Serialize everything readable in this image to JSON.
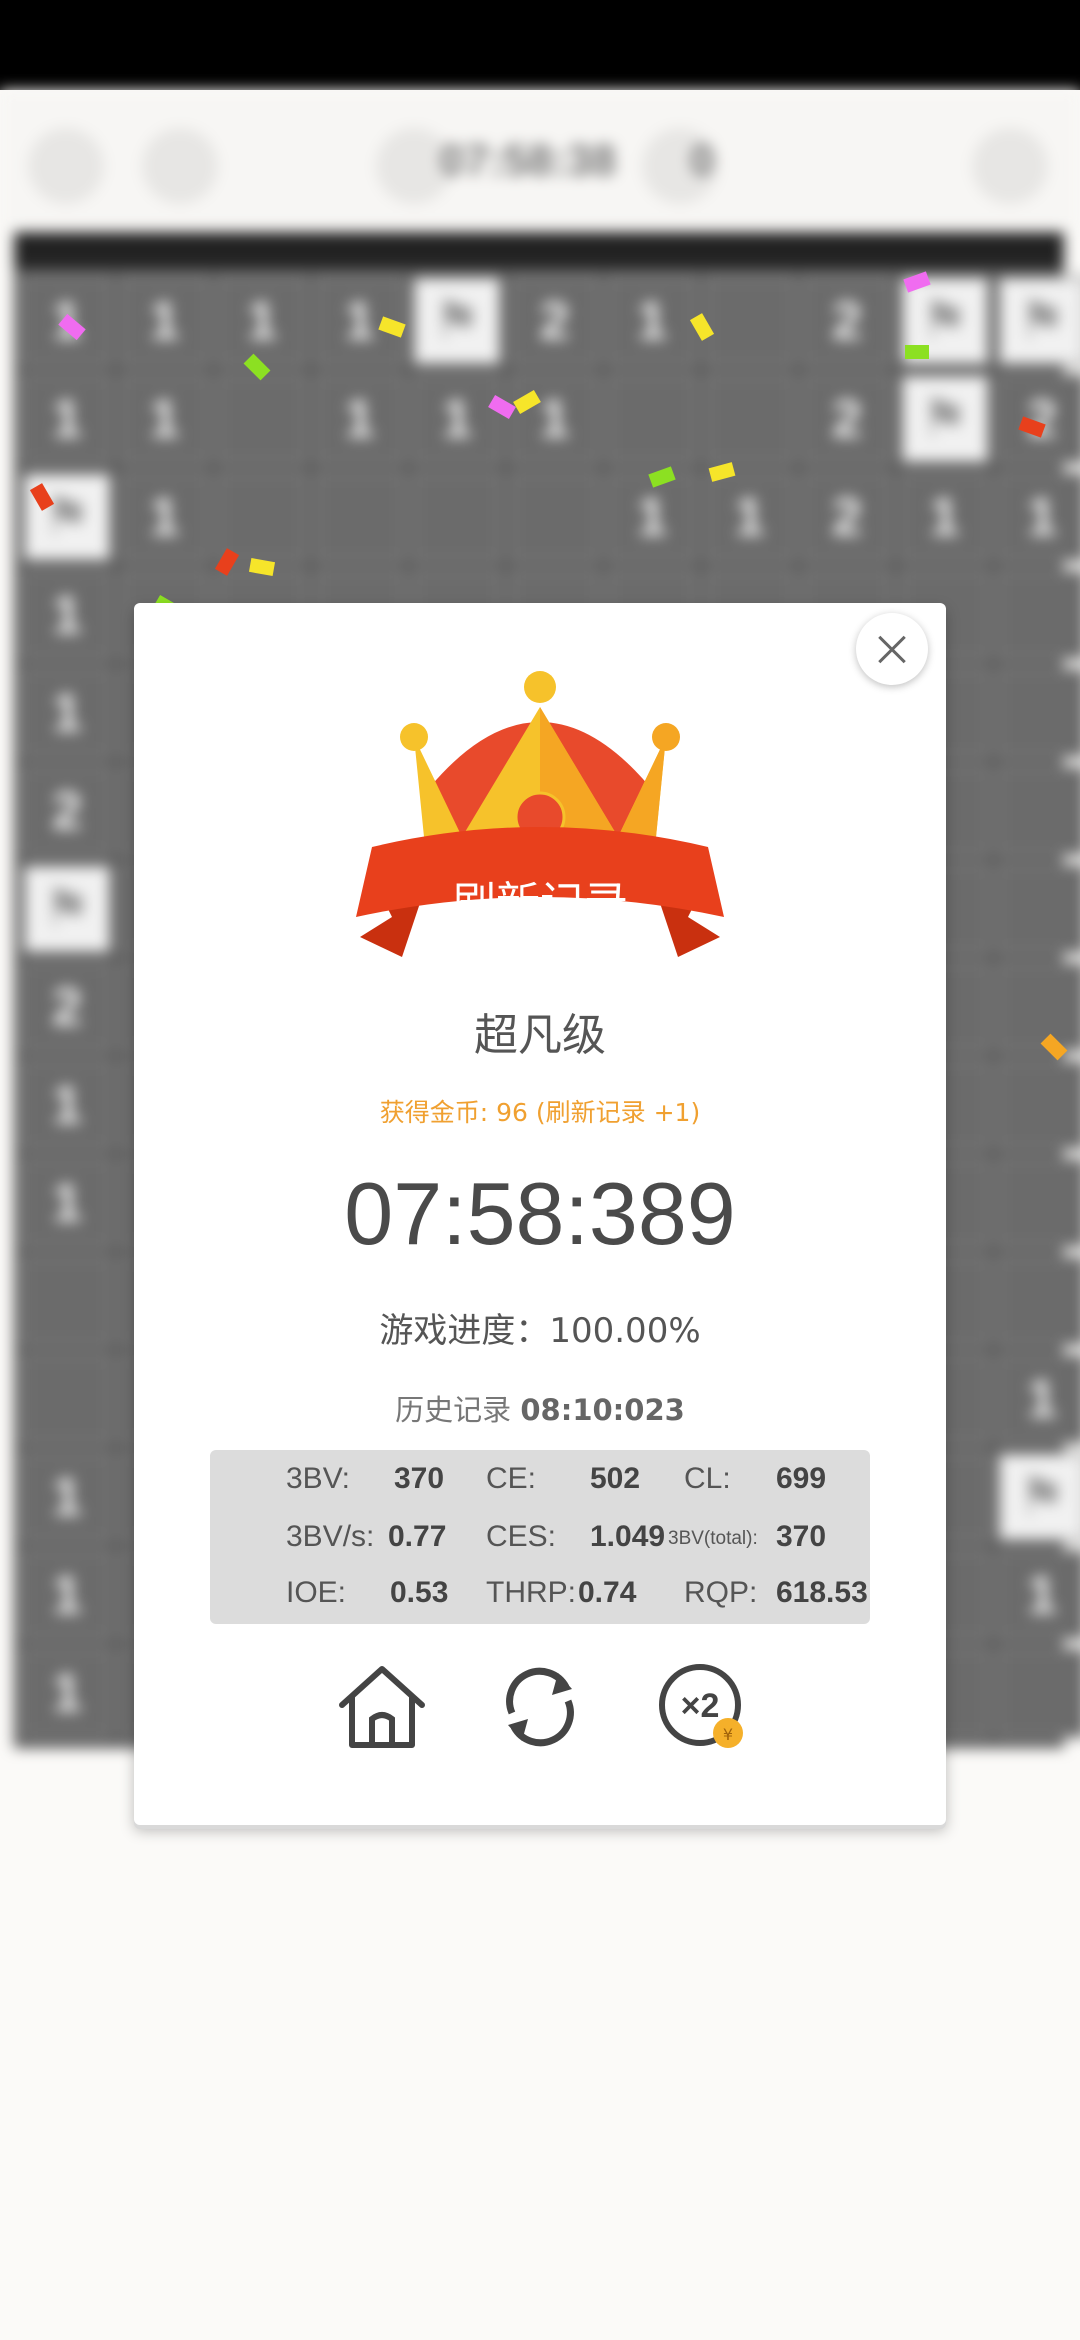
{
  "toolbar": {
    "timer": "07:58:38",
    "flags": "0"
  },
  "board": {
    "rows": [
      [
        "1",
        "1",
        "1",
        "1",
        "F",
        "2",
        "1",
        "",
        "2",
        "F",
        "F"
      ],
      [
        "1",
        "1",
        "",
        "1",
        "1",
        "1",
        "",
        "",
        "2",
        "F",
        "2"
      ],
      [
        "F",
        "1",
        "",
        "",
        "",
        "",
        "1",
        "1",
        "2",
        "1",
        "1"
      ],
      [
        "1",
        "",
        "",
        "",
        "",
        "",
        "",
        "",
        "",
        "",
        ""
      ],
      [
        "1",
        "",
        "",
        "",
        "",
        "",
        "",
        "",
        "",
        "",
        ""
      ],
      [
        "2",
        "",
        "",
        "",
        "",
        "",
        "",
        "",
        "",
        "",
        ""
      ],
      [
        "F",
        "",
        "",
        "",
        "",
        "",
        "",
        "",
        "",
        "",
        ""
      ],
      [
        "2",
        "",
        "",
        "",
        "",
        "",
        "",
        "",
        "",
        "",
        ""
      ],
      [
        "1",
        "",
        "",
        "",
        "",
        "",
        "",
        "",
        "",
        "",
        ""
      ],
      [
        "1",
        "",
        "",
        "",
        "",
        "",
        "",
        "",
        "",
        "",
        ""
      ],
      [
        "",
        "",
        "",
        "",
        "",
        "",
        "",
        "",
        "",
        "",
        ""
      ],
      [
        "",
        "",
        "",
        "",
        "",
        "",
        "",
        "",
        "",
        "",
        "1"
      ],
      [
        "1",
        "",
        "",
        "",
        "",
        "",
        "",
        "",
        "",
        "",
        "F"
      ],
      [
        "1",
        "",
        "",
        "",
        "",
        "",
        "",
        "",
        "",
        "",
        "1"
      ],
      [
        "1",
        "",
        "",
        "",
        "",
        "",
        "",
        "",
        "",
        "",
        ""
      ]
    ]
  },
  "result": {
    "ribbon_label": "刷新记录",
    "level": "超凡级",
    "coins": "获得金币: 96 (刷新记录 +1)",
    "time": "07:58:389",
    "progress": "游戏进度：100.00%",
    "history_label": "历史记录 ",
    "history_time": "08:10:023"
  },
  "stats": [
    {
      "label": "3BV:",
      "value": "370"
    },
    {
      "label": "CE:",
      "value": "502"
    },
    {
      "label": "CL:",
      "value": "699"
    },
    {
      "label": "3BV/s:",
      "value": "0.77"
    },
    {
      "label": "CES:",
      "value": "1.049"
    },
    {
      "label": "3BV(total):",
      "value": "370"
    },
    {
      "label": "IOE:",
      "value": "0.53"
    },
    {
      "label": "THRP:",
      "value": "0.74"
    },
    {
      "label": "RQP:",
      "value": "618.53"
    }
  ],
  "actions": [
    {
      "icon": "home-icon"
    },
    {
      "icon": "restart-icon"
    },
    {
      "icon": "double-coins-icon",
      "text": "×2",
      "badge": "¥"
    }
  ],
  "colors": {
    "accent": "#f0a030",
    "ribbon": "#e8401c",
    "crown_gold": "#f6c22b",
    "crown_red": "#e84a2c"
  }
}
